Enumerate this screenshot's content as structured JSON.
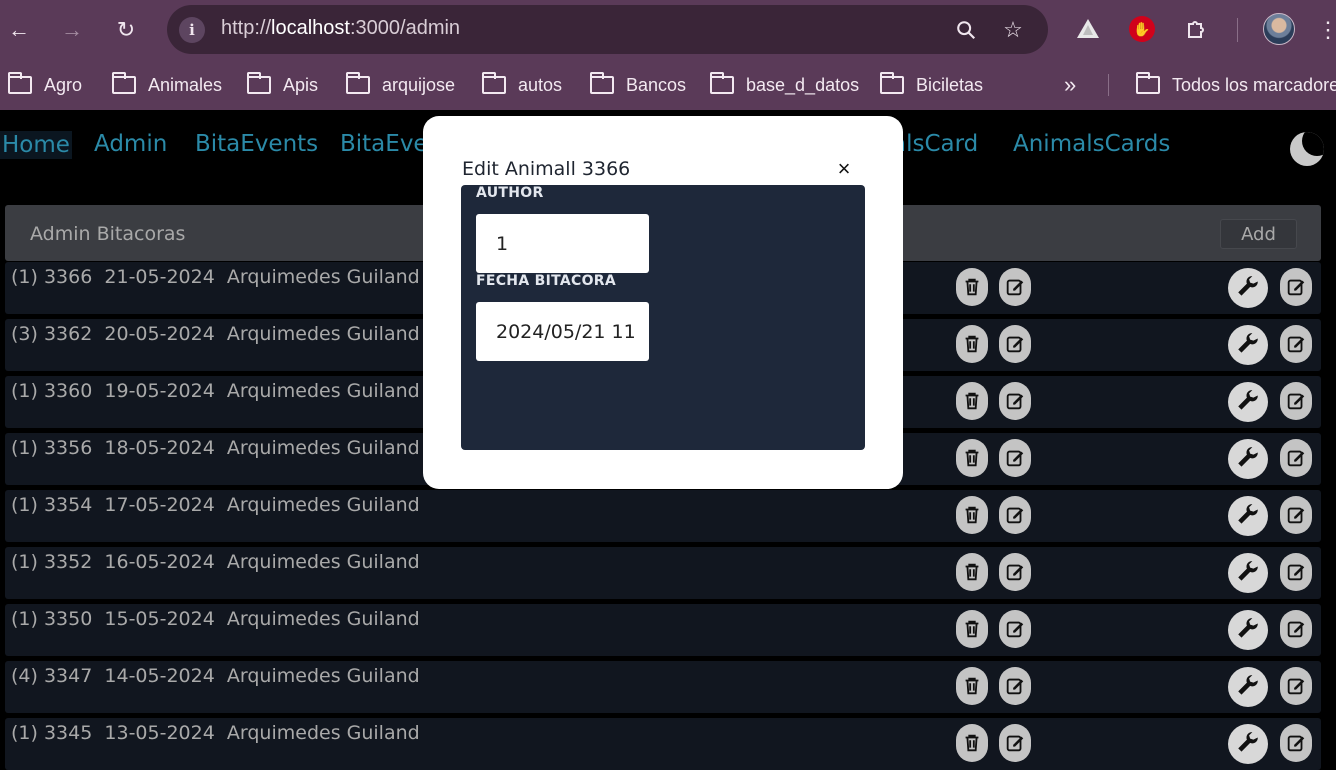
{
  "browser": {
    "url_prefix": "http://",
    "url_host": "localhost",
    "url_rest": ":3000/admin",
    "bookmarks": [
      "Agro",
      "Animales",
      "Apis",
      "arquijose",
      "autos",
      "Bancos",
      "base_d_datos",
      "Biciletas"
    ],
    "all_bookmarks_label": "Todos los marcadores"
  },
  "app": {
    "nav": [
      "Home",
      "Admin",
      "BitaEvents",
      "BitaEve",
      "alsCard",
      "AnimalsCards"
    ],
    "panel_title": "Admin Bitacoras",
    "add_label": "Add",
    "rows": [
      "(1) 3366  21-05-2024  Arquimedes Guiland",
      "(3) 3362  20-05-2024  Arquimedes Guiland",
      "(1) 3360  19-05-2024  Arquimedes Guiland",
      "(1) 3356  18-05-2024  Arquimedes Guiland",
      "(1) 3354  17-05-2024  Arquimedes Guiland",
      "(1) 3352  16-05-2024  Arquimedes Guiland",
      "(1) 3350  15-05-2024  Arquimedes Guiland",
      "(4) 3347  14-05-2024  Arquimedes Guiland",
      "(1) 3345  13-05-2024  Arquimedes Guiland"
    ]
  },
  "modal": {
    "title": "Edit Animall 3366",
    "close": "×",
    "author_label": "AUTHOR",
    "author_value": "1",
    "fecha_label": "FECHA BITACORA",
    "fecha_value": "2024/05/21 11"
  },
  "colors": {
    "chrome": "#5a3a58",
    "nav_link": "#2b8aa8",
    "row_bg": "#11161f",
    "modal_body": "#1e283a"
  }
}
